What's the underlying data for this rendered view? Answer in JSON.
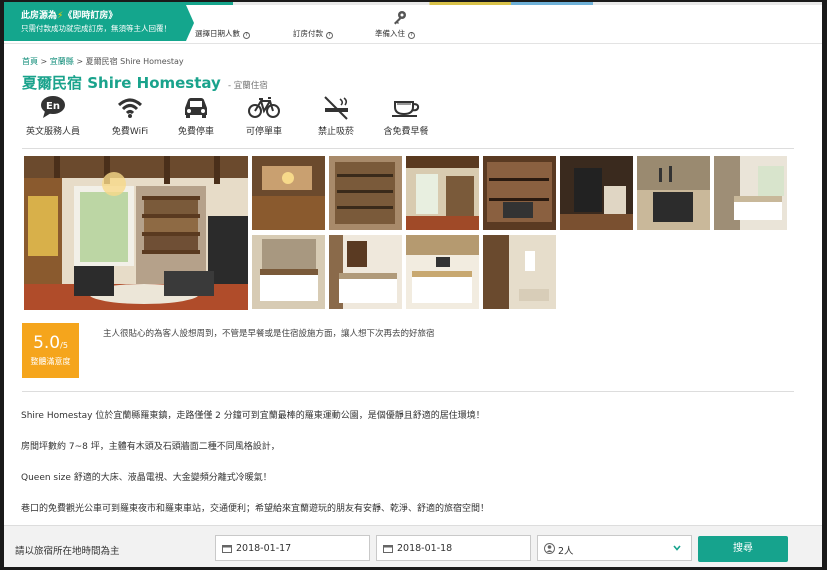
{
  "promo": {
    "line1_prefix": "此房源為",
    "line1_suffix": "《即時訂房》",
    "line2": "只需付款成功就完成訂房，無須等主人回覆！"
  },
  "steps": {
    "select_dates": "選擇日期人數",
    "pay": "訂房付款",
    "checkin": "準備入住"
  },
  "breadcrumb": [
    "首頁",
    "宜蘭縣",
    "夏爾民宿 Shire Homestay"
  ],
  "listing": {
    "title": "夏爾民宿 Shire Homestay",
    "subtitle": "- 宜蘭住宿"
  },
  "amenities": [
    {
      "icon": "english-speaking-icon",
      "label": "英文服務人員"
    },
    {
      "icon": "wifi-icon",
      "label": "免費WiFi"
    },
    {
      "icon": "parking-icon",
      "label": "免費停車"
    },
    {
      "icon": "bicycle-icon",
      "label": "可停單車"
    },
    {
      "icon": "no-smoking-icon",
      "label": "禁止吸菸"
    },
    {
      "icon": "breakfast-icon",
      "label": "含免費早餐"
    }
  ],
  "rating": {
    "score": "5.0",
    "max": "/5",
    "label": "整體滿意度",
    "review": "主人很貼心的為客人設想周到，不管是早餐或是住宿設施方面，讓人想下次再去的好旅宿"
  },
  "description": [
    "Shire Homestay 位於宜蘭縣羅東鎮，走路僅僅 2 分鐘可到宜蘭最棒的羅東運動公園，是個優靜且舒適的居住環境！",
    "房間坪數約 7~8 坪，主體有木頭及石頭牆面二種不同風格設計，",
    "Queen size 舒適的大床、液晶電視、大金變頻分離式冷暖氣！",
    "巷口的免費觀光公車可到羅東夜市和羅東車站，交通便利；希望給來宜蘭遊玩的朋友有安靜、乾淨、舒適的旅宿空間！"
  ],
  "search": {
    "label": "請以旅宿所在地時間為主",
    "checkin": "2018-01-17",
    "checkout": "2018-01-18",
    "guests": "2人",
    "button": "搜尋"
  },
  "colors": {
    "brand": "#16a38d",
    "score": "#f5a51c"
  }
}
